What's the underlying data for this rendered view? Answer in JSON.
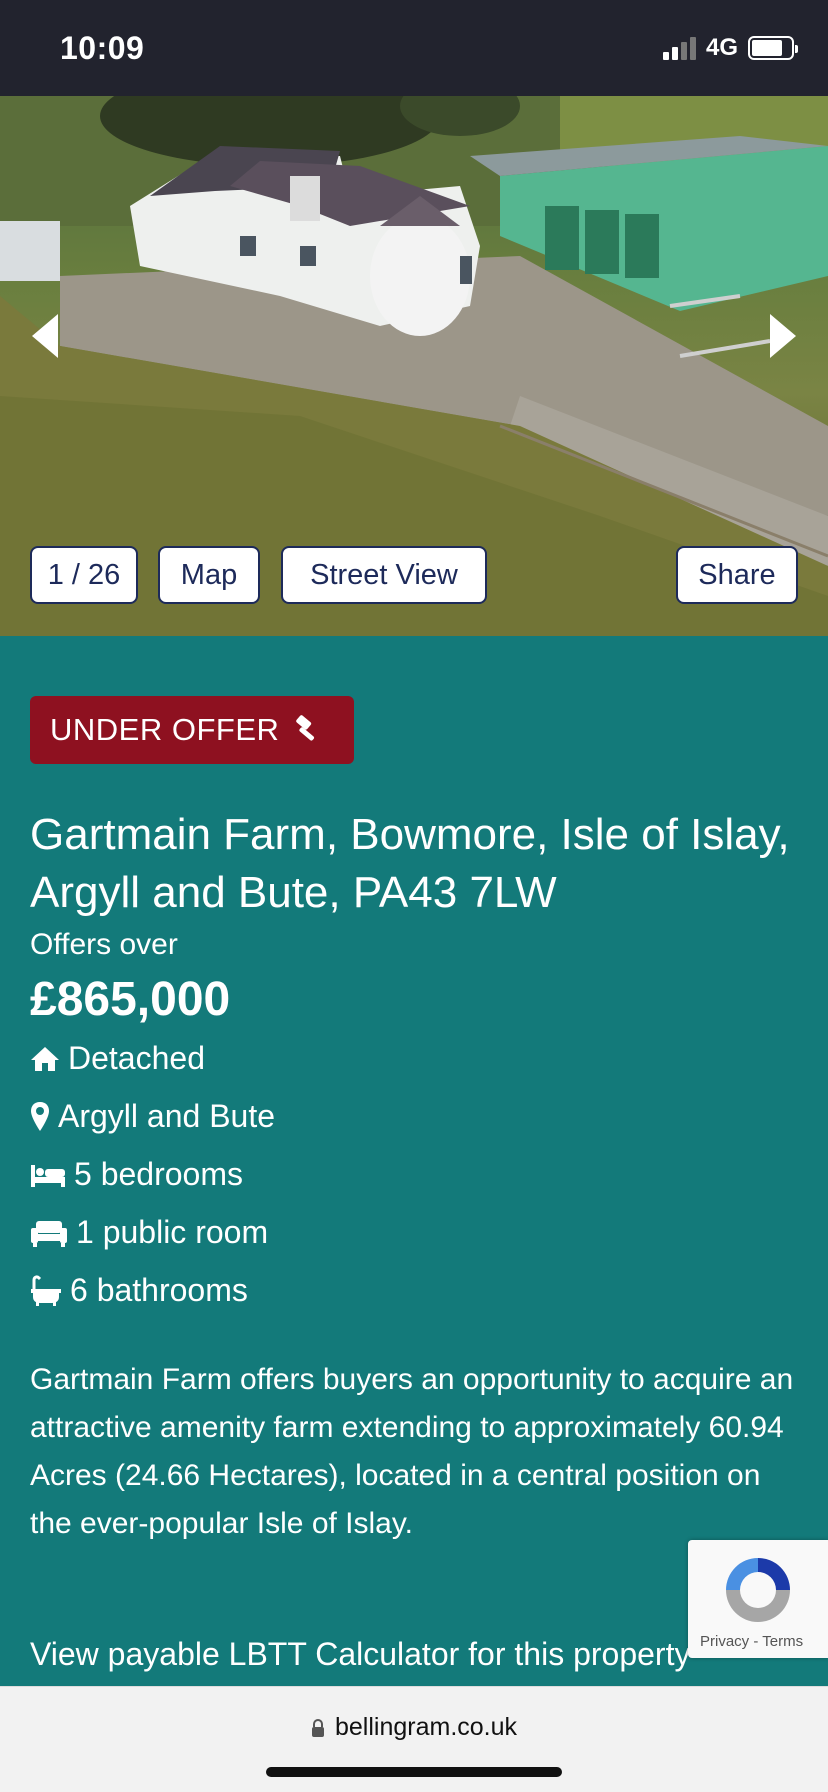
{
  "status_bar": {
    "time": "10:09",
    "network": "4G"
  },
  "gallery": {
    "counter": "1 / 26",
    "map_label": "Map",
    "street_view_label": "Street View",
    "share_label": "Share",
    "prev_icon": "chevron-left-icon",
    "next_icon": "chevron-right-icon"
  },
  "listing": {
    "status_badge": "UNDER OFFER",
    "badge_icon": "gavel-icon",
    "badge_color": "#8e1120",
    "address": "Gartmain Farm, Bowmore, Isle of Islay, Argyll and Bute, PA43 7LW",
    "price_qualifier": "Offers over",
    "price": "£865,000",
    "features": [
      {
        "icon": "house-icon",
        "text": "Detached"
      },
      {
        "icon": "map-pin-icon",
        "text": "Argyll and Bute"
      },
      {
        "icon": "bed-icon",
        "text": "5 bedrooms"
      },
      {
        "icon": "sofa-icon",
        "text": "1 public room"
      },
      {
        "icon": "bath-icon",
        "text": "6 bathrooms"
      }
    ],
    "description": "Gartmain Farm offers buyers an opportunity to acquire an attractive amenity farm extending to approximately 60.94 Acres (24.66 Hectares), located in a central position on the ever-popular Isle of Islay.",
    "lbtt_link": "View payable LBTT Calculator for this property"
  },
  "recaptcha": {
    "privacy": "Privacy",
    "separator": "-",
    "terms": "Terms"
  },
  "browser": {
    "url": "bellingram.co.uk"
  },
  "colors": {
    "background": "#137a7a",
    "button_border": "#1d2a5a",
    "status_bar": "#22232e"
  }
}
